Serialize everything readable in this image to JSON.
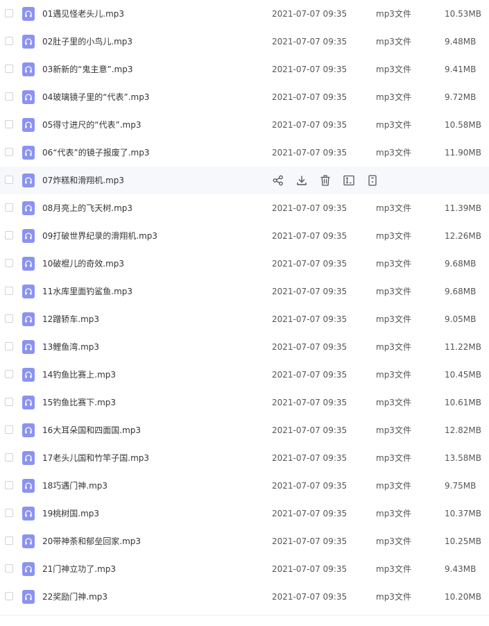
{
  "files": [
    {
      "name": "01遇见怪老头儿.mp3",
      "date": "2021-07-07 09:35",
      "type": "mp3文件",
      "size": "10.53MB"
    },
    {
      "name": "02肚子里的小鸟儿.mp3",
      "date": "2021-07-07 09:35",
      "type": "mp3文件",
      "size": "9.48MB"
    },
    {
      "name": "03新新的“鬼主意”.mp3",
      "date": "2021-07-07 09:35",
      "type": "mp3文件",
      "size": "9.41MB"
    },
    {
      "name": "04玻璃镜子里的“代表”.mp3",
      "date": "2021-07-07 09:35",
      "type": "mp3文件",
      "size": "9.72MB"
    },
    {
      "name": "05得寸进尺的“代表”.mp3",
      "date": "2021-07-07 09:35",
      "type": "mp3文件",
      "size": "10.58MB"
    },
    {
      "name": "06“代表”的镜子报废了.mp3",
      "date": "2021-07-07 09:35",
      "type": "mp3文件",
      "size": "11.90MB"
    },
    {
      "name": "07炸糕和滑翔机.mp3",
      "date": "",
      "type": "",
      "size": ""
    },
    {
      "name": "08月亮上的飞天树.mp3",
      "date": "2021-07-07 09:35",
      "type": "mp3文件",
      "size": "11.39MB"
    },
    {
      "name": "09打破世界纪录的滑翔机.mp3",
      "date": "2021-07-07 09:35",
      "type": "mp3文件",
      "size": "12.26MB"
    },
    {
      "name": "10破棍儿的奇效.mp3",
      "date": "2021-07-07 09:35",
      "type": "mp3文件",
      "size": "9.68MB"
    },
    {
      "name": "11水库里面钓鲨鱼.mp3",
      "date": "2021-07-07 09:35",
      "type": "mp3文件",
      "size": "9.68MB"
    },
    {
      "name": "12蹭轿车.mp3",
      "date": "2021-07-07 09:35",
      "type": "mp3文件",
      "size": "9.05MB"
    },
    {
      "name": "13鲤鱼湾.mp3",
      "date": "2021-07-07 09:35",
      "type": "mp3文件",
      "size": "11.22MB"
    },
    {
      "name": "14钓鱼比赛上.mp3",
      "date": "2021-07-07 09:35",
      "type": "mp3文件",
      "size": "10.45MB"
    },
    {
      "name": "15钓鱼比赛下.mp3",
      "date": "2021-07-07 09:35",
      "type": "mp3文件",
      "size": "10.61MB"
    },
    {
      "name": "16大耳朵国和四面国.mp3",
      "date": "2021-07-07 09:35",
      "type": "mp3文件",
      "size": "12.82MB"
    },
    {
      "name": "17老头儿国和竹竿子国.mp3",
      "date": "2021-07-07 09:35",
      "type": "mp3文件",
      "size": "13.58MB"
    },
    {
      "name": "18巧遇门神.mp3",
      "date": "2021-07-07 09:35",
      "type": "mp3文件",
      "size": "9.75MB"
    },
    {
      "name": "19桃树国.mp3",
      "date": "2021-07-07 09:35",
      "type": "mp3文件",
      "size": "10.37MB"
    },
    {
      "name": "20带神荼和郁垒回家.mp3",
      "date": "2021-07-07 09:35",
      "type": "mp3文件",
      "size": "10.25MB"
    },
    {
      "name": "21门神立功了.mp3",
      "date": "2021-07-07 09:35",
      "type": "mp3文件",
      "size": "9.43MB"
    },
    {
      "name": "22奖励门神.mp3",
      "date": "2021-07-07 09:35",
      "type": "mp3文件",
      "size": "10.20MB"
    }
  ],
  "hovered_row_index": 6,
  "row_action_icons": [
    "share-icon",
    "download-icon",
    "delete-icon",
    "rename-icon",
    "more-icon"
  ],
  "colors": {
    "file_icon": "#8b93f0",
    "hover_bg": "#f7f8fc",
    "text": "#333333",
    "meta_text": "#555555"
  }
}
